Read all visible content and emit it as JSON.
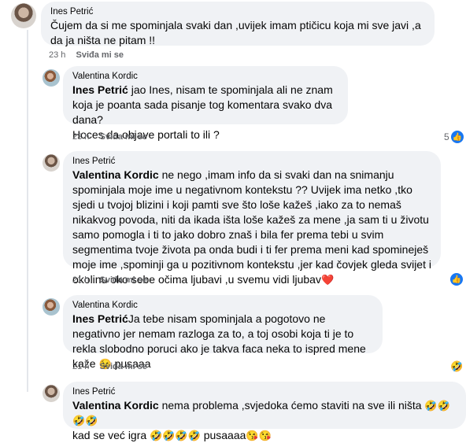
{
  "comments": [
    {
      "author": "Ines Petrić",
      "text": "Čujem da si me spominjala svaki dan ,uvijek imam ptičicu koja mi sve javi ,a da ja ništa ne pitam !!",
      "time": "23 h",
      "like": "Sviđa mi se"
    },
    {
      "author": "Valentina Kordic",
      "mention": "Ines Petrić",
      "text": " jao Ines, nisam te spominjala ali ne znam koja je poanta sada pisanje tog komentara svako dva dana?\nHoces da objave portali to ili ?",
      "time": "23 h",
      "like": "Sviđa mi se",
      "reaction_count": "5"
    },
    {
      "author": "Ines Petrić",
      "mention": "Valentina Kordic",
      "text": " ne nego ,imam info da si svaki dan na snimanju spominjala moje ime u negativnom kontekstu ?? Uvijek ima netko ,tko sjedi u tvojoj blizini i koji pamti sve što loše kažeš ,iako za to nemaš nikakvog povoda, niti da ikada išta loše kažeš za mene ,ja sam ti u životu samo pomogla i ti to jako dobro znaš i bila fer prema tebi u svim segmentima tvoje života pa onda budi i ti fer prema meni kad spomineješ moje ime ,spominji ga u pozitivnom kontekstu ,jer kad čovjek gleda svijet i okolinu oko sebe očima ljubavi ,u svemu vidi ljubav",
      "emoji": "❤️",
      "time": "21 h",
      "like": "Sviđa mi se"
    },
    {
      "author": "Valentina Kordic",
      "mention": "Ines Petrić",
      "text": "Ja tebe nisam spominjala a pogotovo ne negativno jer nemam razloga za to, a toj osobi koja ti je to rekla slobodno poruci ako je takva faca neka to ispred mene kaže ",
      "emoji": "😉",
      "text_after": " pusaaa",
      "time": "21 h",
      "like": "Sviđa mi se"
    },
    {
      "author": "Ines Petrić",
      "mention": "Valentina Kordic",
      "text": " nema problema ,svjedoka ćemo staviti na sve ili ništa ",
      "emoji": "🤣🤣🤣🤣",
      "text2": "\nkad se već igra ",
      "emoji2": "🤣🤣🤣🤣",
      "text_after": " pusaaaa",
      "emoji3": "😘😘"
    }
  ],
  "colors": {
    "like_blue": "#1877f2",
    "bubble": "#f0f2f5",
    "meta": "#65676b"
  },
  "icons": [
    "like-icon",
    "haha-icon"
  ]
}
